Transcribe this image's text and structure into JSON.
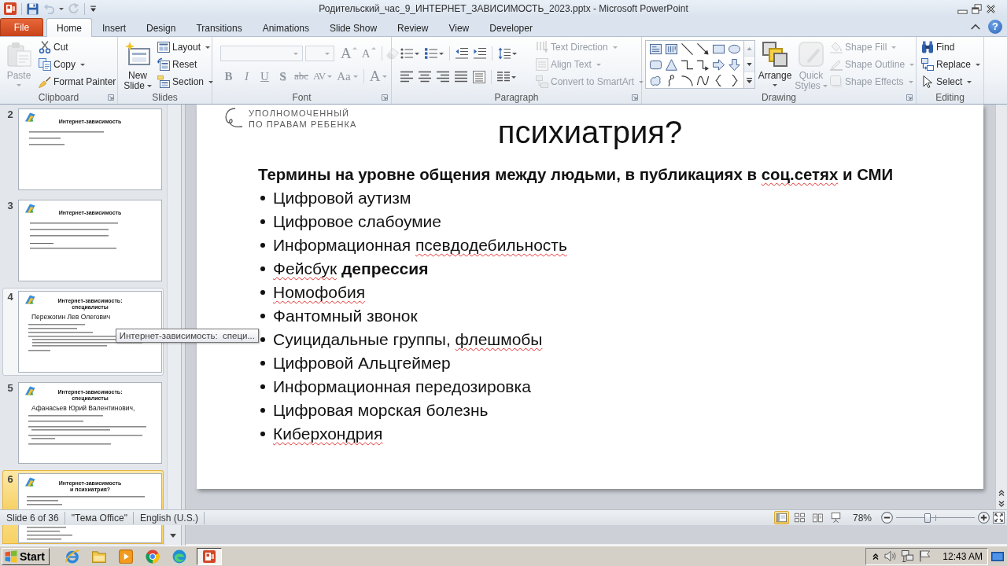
{
  "window": {
    "title": "Родительский_час_9_ИНТЕРНЕТ_ЗАВИСИМОСТЬ_2023.pptx - Microsoft PowerPoint",
    "undo_disabled": true,
    "redo_disabled": true
  },
  "tabs": [
    {
      "label": "File",
      "kind": "file",
      "selected": false
    },
    {
      "label": "Home",
      "kind": "tab",
      "selected": true
    },
    {
      "label": "Insert",
      "kind": "tab",
      "selected": false
    },
    {
      "label": "Design",
      "kind": "tab",
      "selected": false
    },
    {
      "label": "Transitions",
      "kind": "tab",
      "selected": false
    },
    {
      "label": "Animations",
      "kind": "tab",
      "selected": false
    },
    {
      "label": "Slide Show",
      "kind": "tab",
      "selected": false
    },
    {
      "label": "Review",
      "kind": "tab",
      "selected": false
    },
    {
      "label": "View",
      "kind": "tab",
      "selected": false
    },
    {
      "label": "Developer",
      "kind": "tab",
      "selected": false
    }
  ],
  "help_button": {
    "label": "?"
  },
  "ribbon": {
    "clipboard": {
      "label": "Clipboard",
      "paste": {
        "label": "Paste",
        "disabled": true,
        "dropdown": true
      },
      "commands": [
        {
          "label": "Cut",
          "disabled": false,
          "dropdown": false
        },
        {
          "label": "Copy",
          "disabled": false,
          "dropdown": true
        },
        {
          "label": "Format Painter",
          "disabled": false,
          "dropdown": false
        }
      ]
    },
    "slides": {
      "label": "Slides",
      "new_slide": {
        "label": "New Slide",
        "disabled": false,
        "dropdown": true
      },
      "commands": [
        {
          "label": "Layout",
          "disabled": false,
          "dropdown": true
        },
        {
          "label": "Reset",
          "disabled": false,
          "dropdown": false
        },
        {
          "label": "Section",
          "disabled": false,
          "dropdown": true
        }
      ]
    },
    "font": {
      "label": "Font",
      "font_name": {
        "disabled": true
      },
      "font_size": {
        "disabled": true
      },
      "size_buttons": [
        {
          "label": "A",
          "kind": "grow",
          "disabled": true
        },
        {
          "label": "A",
          "kind": "shrink",
          "disabled": true
        }
      ],
      "clear_formatting": {
        "disabled": true
      },
      "format_buttons": [
        {
          "label": "B",
          "kind": "bold",
          "disabled": true,
          "dropdown": false
        },
        {
          "label": "I",
          "kind": "italic",
          "disabled": true,
          "dropdown": false
        },
        {
          "label": "U",
          "kind": "underline",
          "disabled": true,
          "dropdown": false
        },
        {
          "label": "S",
          "kind": "shadow",
          "disabled": true,
          "dropdown": false
        },
        {
          "label": "abc",
          "kind": "strikethrough",
          "disabled": true,
          "dropdown": false
        },
        {
          "label": "AV",
          "kind": "spacing",
          "disabled": true,
          "dropdown": true
        },
        {
          "label": "Aa",
          "kind": "case",
          "disabled": true,
          "dropdown": true
        }
      ],
      "font_color": {
        "label": "A",
        "disabled": true,
        "dropdown": true
      }
    },
    "paragraph": {
      "label": "Paragraph",
      "row_1": [
        {
          "dropdown": true
        },
        {
          "dropdown": true
        },
        {
          "dropdown": false
        },
        {
          "dropdown": false
        },
        {
          "dropdown": true
        }
      ],
      "row_2": [
        {
          "dropdown": false
        },
        {
          "dropdown": false
        },
        {
          "dropdown": false
        },
        {
          "dropdown": false
        },
        {
          "dropdown": false
        },
        {
          "dropdown": true
        }
      ],
      "commands": [
        {
          "label": "Text Direction",
          "disabled": true,
          "dropdown": true
        },
        {
          "label": "Align Text",
          "disabled": true,
          "dropdown": true
        },
        {
          "label": "Convert to SmartArt",
          "disabled": true,
          "dropdown": true
        }
      ]
    },
    "drawing": {
      "label": "Drawing",
      "arrange": {
        "label": "Arrange",
        "disabled": false,
        "dropdown": true
      },
      "quick_styles": {
        "label": "Quick Styles",
        "disabled": true,
        "dropdown": true
      },
      "commands": [
        {
          "label": "Shape Fill",
          "disabled": true,
          "dropdown": true
        },
        {
          "label": "Shape Outline",
          "disabled": true,
          "dropdown": true
        },
        {
          "label": "Shape Effects",
          "disabled": true,
          "dropdown": true
        }
      ]
    },
    "editing": {
      "label": "Editing",
      "commands": [
        {
          "label": "Find",
          "disabled": false,
          "dropdown": false
        },
        {
          "label": "Replace",
          "disabled": false,
          "dropdown": true
        },
        {
          "label": "Select",
          "disabled": false,
          "dropdown": true
        }
      ]
    }
  },
  "slide_thumbnails": [
    {
      "number": "2",
      "title": "Интернет-зависимость",
      "selected": false,
      "hovered": false
    },
    {
      "number": "3",
      "title": "Интернет-зависимость",
      "selected": false,
      "hovered": false
    },
    {
      "number": "4",
      "title": "Интернет-зависимость:\nспециалисты",
      "name": "Пережогин Лев Олегович",
      "selected": false,
      "hovered": true
    },
    {
      "number": "5",
      "title": "Интернет-зависимость:\nспециалисты",
      "name": "Афанасьев Юрий Валентинович,",
      "selected": false,
      "hovered": false
    },
    {
      "number": "6",
      "title": "Интернет-зависимость\nи психиатрия?",
      "selected": true,
      "hovered": false
    }
  ],
  "tooltip": {
    "text": "Интернет-зависимость:  специ..."
  },
  "slide": {
    "logo_text": "УПОЛНОМОЧЕННЫЙ\nПО ПРАВАМ РЕБЕНКА",
    "title": "психиатрия?",
    "lead": {
      "segments": [
        {
          "text": "Термины на уровне общения между людьми, в публикациях в ",
          "misspelled": false
        },
        {
          "text": "соц.сетях",
          "misspelled": true
        },
        {
          "text": " и СМИ",
          "misspelled": false
        }
      ]
    },
    "bullets": [
      {
        "segments": [
          {
            "text": "Цифровой аутизм",
            "misspelled": false
          }
        ]
      },
      {
        "segments": [
          {
            "text": "Цифровое слабоумие",
            "misspelled": false
          }
        ]
      },
      {
        "segments": [
          {
            "text": "Информационная ",
            "misspelled": false
          },
          {
            "text": "псевдодебильность",
            "misspelled": true
          }
        ]
      },
      {
        "segments": [
          {
            "text": "Фейсбук",
            "misspelled": true
          },
          {
            "text": " **депрессия**",
            "misspelled": false
          }
        ]
      },
      {
        "segments": [
          {
            "text": "Номофобия",
            "misspelled": true
          }
        ]
      },
      {
        "segments": [
          {
            "text": "Фантомный звонок",
            "misspelled": false
          }
        ]
      },
      {
        "segments": [
          {
            "text": "Суицидальные группы, ",
            "misspelled": false
          },
          {
            "text": "флешмобы",
            "misspelled": true
          }
        ]
      },
      {
        "segments": [
          {
            "text": "Цифровой Альцгеймер",
            "misspelled": false
          }
        ]
      },
      {
        "segments": [
          {
            "text": "Информационная передозировка",
            "misspelled": false
          }
        ]
      },
      {
        "segments": [
          {
            "text": "Цифровая морская болезнь",
            "misspelled": false
          }
        ]
      },
      {
        "segments": [
          {
            "text": "Киберхондрия",
            "misspelled": true
          }
        ]
      }
    ]
  },
  "status_bar": {
    "slide_info": "Slide 6 of 36",
    "theme": "\"Тема Office\"",
    "language": "English (U.S.)",
    "views": [
      {
        "selected": true
      },
      {
        "selected": false
      },
      {
        "selected": false
      },
      {
        "selected": false
      }
    ],
    "zoom": "78%",
    "zoom_slider": {
      "level": 0.4
    }
  },
  "taskbar": {
    "start": "Start",
    "task_button": {
      "active": true
    },
    "clock": "12:43 AM"
  }
}
